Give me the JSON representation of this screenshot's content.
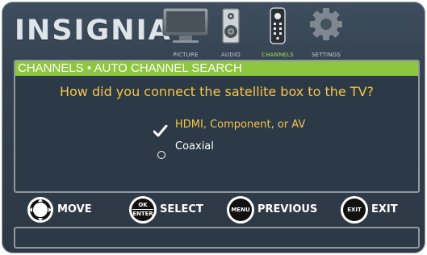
{
  "header": {
    "logo": "INSIGNIA",
    "tabs": [
      {
        "label": "PICTURE",
        "icon": "tv-icon",
        "active": false
      },
      {
        "label": "AUDIO",
        "icon": "speaker-icon",
        "active": false
      },
      {
        "label": "CHANNELS",
        "icon": "remote-icon",
        "active": true
      },
      {
        "label": "SETTINGS",
        "icon": "gear-icon",
        "active": false
      }
    ]
  },
  "panel": {
    "title": "CHANNELS • AUTO CHANNEL SEARCH",
    "question": "How did you connect the satellite box to the TV?",
    "options": [
      {
        "label": "HDMI, Component, or AV",
        "selected": true
      },
      {
        "label": "Coaxial",
        "selected": false
      }
    ]
  },
  "hints": [
    {
      "button": "",
      "label": "MOVE",
      "icon": "dpad-icon"
    },
    {
      "button": "OK / ENTER",
      "button_top": "OK",
      "button_bottom": "ENTER",
      "label": "SELECT"
    },
    {
      "button": "MENU",
      "label": "PREVIOUS"
    },
    {
      "button": "EXIT",
      "label": "EXIT"
    }
  ],
  "colors": {
    "accent": "#8dc63f",
    "highlight": "#f6c54a",
    "panel_bg": "#2c3946",
    "screen_bg": "#34414f"
  }
}
